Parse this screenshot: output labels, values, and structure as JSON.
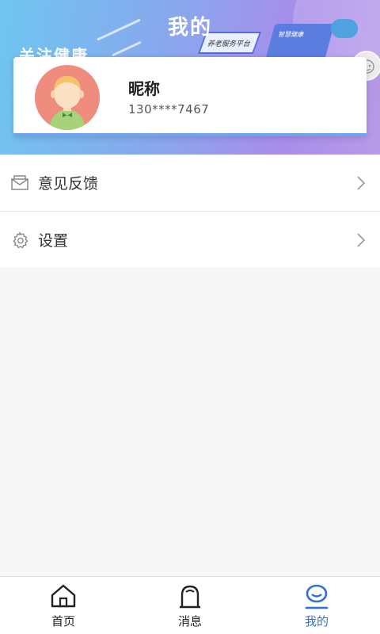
{
  "header": {
    "title": "我的",
    "slogan": "关注健康",
    "board_text": "养老服务平台",
    "box_text": "智慧健康"
  },
  "profile": {
    "nickname": "昵称",
    "phone": "130****7467"
  },
  "menu": {
    "items": [
      {
        "label": "意见反馈",
        "icon": "mail-icon"
      },
      {
        "label": "设置",
        "icon": "gear-icon"
      }
    ]
  },
  "tabbar": {
    "tabs": [
      {
        "label": "首页",
        "icon": "home-icon",
        "active": false
      },
      {
        "label": "消息",
        "icon": "bell-icon",
        "active": false
      },
      {
        "label": "我的",
        "icon": "user-icon",
        "active": true
      }
    ]
  },
  "colors": {
    "accent": "#2f6fd6",
    "avatar_bg": "#ee8d7e",
    "header_start": "#6ec6f0",
    "header_end": "#b79be8"
  }
}
